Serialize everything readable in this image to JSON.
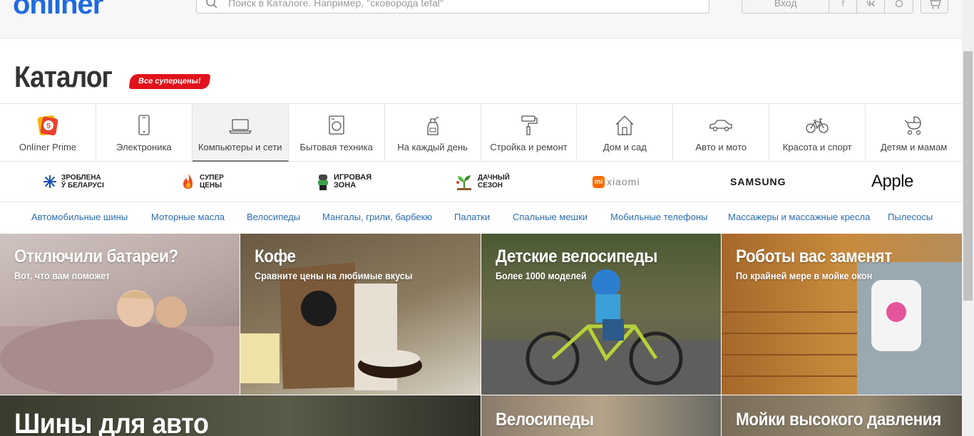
{
  "header": {
    "logo": "onliner",
    "search_placeholder": "Поиск в Каталоге. Например, \"сковорода tefal\"",
    "login_label": "Вход"
  },
  "catalog": {
    "title": "Каталог",
    "badge": "Все суперцены!"
  },
  "categories": [
    {
      "label": "Onlíner Prime",
      "icon": "prime-icon"
    },
    {
      "label": "Электроника",
      "icon": "phone-icon"
    },
    {
      "label": "Компьютеры и сети",
      "icon": "laptop-icon",
      "active": true
    },
    {
      "label": "Бытовая техника",
      "icon": "washer-icon"
    },
    {
      "label": "На каждый день",
      "icon": "spray-bottle-icon"
    },
    {
      "label": "Стройка и ремонт",
      "icon": "paint-roller-icon"
    },
    {
      "label": "Дом и сад",
      "icon": "house-icon"
    },
    {
      "label": "Авто и мото",
      "icon": "car-icon"
    },
    {
      "label": "Красота и спорт",
      "icon": "bicycle-icon"
    },
    {
      "label": "Детям и мамам",
      "icon": "stroller-icon"
    }
  ],
  "brands": [
    {
      "line1": "ЗРОБЛЕНА",
      "line2": "Ў БЕЛАРУСІ",
      "icon": "snowflake-icon"
    },
    {
      "line1": "СУПЕР",
      "line2": "ЦЕНЫ",
      "icon": "flame-icon"
    },
    {
      "line1": "ИГРОВАЯ",
      "line2": "ЗОНА",
      "icon": "gamer-icon"
    },
    {
      "line1": "ДАЧНЫЙ",
      "line2": "СЕЗОН",
      "icon": "seedling-icon"
    },
    {
      "label": "xiaomi",
      "icon": "xiaomi-logo"
    },
    {
      "label": "SAMSUNG"
    },
    {
      "label": "Apple"
    }
  ],
  "tags": [
    "Автомобильные шины",
    "Моторные масла",
    "Велосипеды",
    "Мангалы, грили, барбекю",
    "Палатки",
    "Спальные мешки",
    "Мобильные телефоны",
    "Массажеры и массажные кресла",
    "Пылесосы"
  ],
  "tiles": [
    {
      "title": "Отключили батареи?",
      "subtitle": "Вот, что вам поможет"
    },
    {
      "title": "Кофе",
      "subtitle": "Сравните цены на любимые вкусы"
    },
    {
      "title": "Детские велосипеды",
      "subtitle": "Более 1000 моделей"
    },
    {
      "title": "Роботы вас заменят",
      "subtitle": "По крайней мере в мойке окон"
    },
    {
      "title": "Шины для авто",
      "subtitle": ""
    },
    {
      "title": "Велосипеды",
      "subtitle": ""
    },
    {
      "title": "Мойки высокого давления",
      "subtitle": ""
    }
  ],
  "colors": {
    "accent_blue": "#1f6ae0",
    "badge_red": "#e1121b",
    "tag_link": "#2a6db0"
  }
}
